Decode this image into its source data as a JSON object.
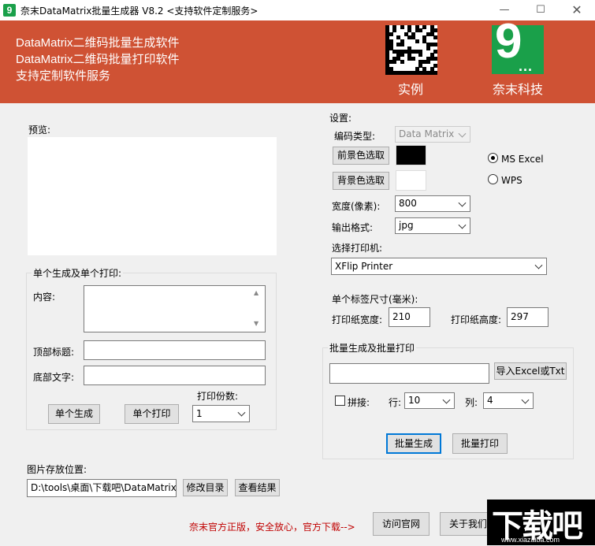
{
  "window": {
    "title": "奈末DataMatrix批量生成器 V8.2  <支持软件定制服务>",
    "app_icon_glyph": "9"
  },
  "banner": {
    "lines": [
      "DataMatrix二维码批量生成软件",
      "DataMatrix二维码批量打印软件",
      "支持定制软件服务"
    ],
    "example_caption": "实例",
    "company_caption": "奈末科技",
    "logo_glyph": "9",
    "logo_dots": "...",
    "background": "#cf5234"
  },
  "preview": {
    "label": "预览:"
  },
  "single": {
    "legend": "单个生成及单个打印:",
    "content_label": "内容:",
    "content_value": "",
    "top_title_label": "顶部标题:",
    "top_title_value": "",
    "bottom_text_label": "底部文字:",
    "bottom_text_value": "",
    "copies_label": "打印份数:",
    "copies_value": "1",
    "generate_button": "单个生成",
    "print_button": "单个打印"
  },
  "storage": {
    "label": "图片存放位置:",
    "path": "D:\\tools\\桌面\\下载吧\\DataMatrixG",
    "change_button": "修改目录",
    "view_button": "查看结果"
  },
  "settings": {
    "legend": "设置:",
    "encoding_label": "编码类型:",
    "encoding_value": "Data Matrix",
    "fg_button": "前景色选取",
    "fg_color": "#000000",
    "bg_button": "背景色选取",
    "bg_color": "#ffffff",
    "radio_ms_excel": "MS  Excel",
    "radio_wps": "WPS",
    "selected_radio": "MS  Excel",
    "width_label": "宽度(像素):",
    "width_value": "800",
    "format_label": "输出格式:",
    "format_value": "jpg",
    "printer_label": "选择打印机:",
    "printer_value": "XFlip Printer",
    "label_size_label": "单个标签尺寸(毫米):",
    "paper_width_label": "打印纸宽度:",
    "paper_width_value": "210",
    "paper_height_label": "打印纸高度:",
    "paper_height_value": "297"
  },
  "batch": {
    "legend": "批量生成及批量打印",
    "file_value": "",
    "import_button": "导入Excel或Txt",
    "join_label": "拼接:",
    "join_checked": false,
    "rows_label": "行:",
    "rows_value": "10",
    "cols_label": "列:",
    "cols_value": "4",
    "generate_button": "批量生成",
    "print_button": "批量打印"
  },
  "footer": {
    "notice": "奈末官方正版，安全放心，官方下载-->",
    "notice_color": "#c00000",
    "visit_button": "访问官网",
    "about_button": "关于我们"
  },
  "watermark": {
    "big": "下载吧",
    "small": "www.xiazaiba.com"
  }
}
